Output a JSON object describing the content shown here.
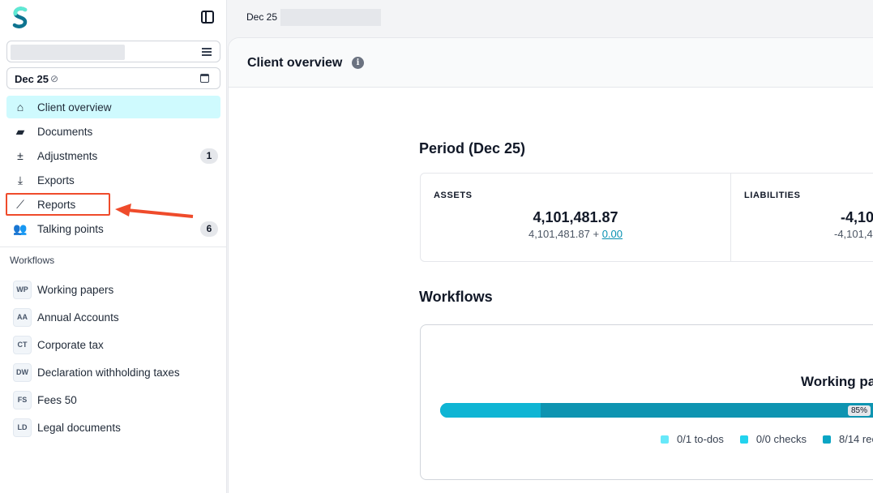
{
  "topbar": {
    "period_label": "Dec 25 |"
  },
  "sidebar": {
    "period": "Dec 25",
    "nav": [
      {
        "label": "Client overview",
        "icon": "home-icon",
        "glyph": "⌂",
        "active": true
      },
      {
        "label": "Documents",
        "icon": "folder-icon",
        "glyph": "▰"
      },
      {
        "label": "Adjustments",
        "icon": "plus-minus-icon",
        "glyph": "±",
        "count": "1"
      },
      {
        "label": "Exports",
        "icon": "download-icon",
        "glyph": "⤓"
      },
      {
        "label": "Reports",
        "icon": "chart-icon",
        "glyph": "⟋"
      },
      {
        "label": "Talking points",
        "icon": "users-icon",
        "glyph": "👥",
        "count": "6"
      }
    ],
    "workflows_heading": "Workflows",
    "workflows": [
      {
        "badge": "WP",
        "label": "Working papers"
      },
      {
        "badge": "AA",
        "label": "Annual Accounts"
      },
      {
        "badge": "CT",
        "label": "Corporate tax"
      },
      {
        "badge": "DW",
        "label": "Declaration withholding taxes"
      },
      {
        "badge": "FS",
        "label": "Fees 50"
      },
      {
        "badge": "LD",
        "label": "Legal documents"
      }
    ]
  },
  "main": {
    "title": "Client overview",
    "period_heading": "Period (Dec 25)",
    "assets": {
      "label": "ASSETS",
      "value": "4,101,481.87",
      "sub_base": "4,101,481.87 + ",
      "sub_link": "0.00"
    },
    "liabilities": {
      "label": "LIABILITIES",
      "value": "-4,10",
      "sub": "-4,101,4"
    },
    "workflows_heading": "Workflows",
    "workflow_card": {
      "title": "Working pa",
      "progress_percent": 85,
      "first_segment_fraction": 0.221,
      "progress_label": "85%",
      "legend": [
        {
          "label": "0/1 to-dos",
          "color": "#67e8f9"
        },
        {
          "label": "0/0 checks",
          "color": "#22d3ee"
        },
        {
          "label": "8/14 rec",
          "color": "#0aa5c4"
        }
      ]
    }
  },
  "colors": {
    "accent": "#0891b2",
    "active_bg": "#cffafe",
    "highlight": "#ef4b2b"
  }
}
